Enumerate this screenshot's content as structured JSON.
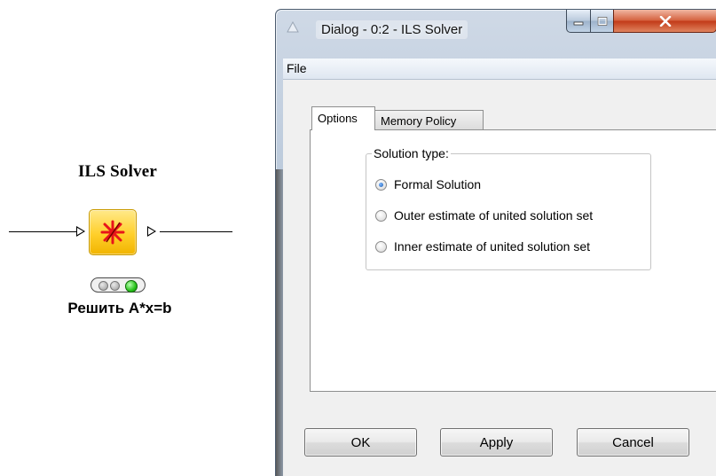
{
  "node": {
    "title": "ILS Solver",
    "label": "Решить A*x=b",
    "status": "executed",
    "icon": "red-star-icon"
  },
  "dialog": {
    "title": "Dialog - 0:2 - ILS Solver",
    "menu": {
      "file_label": "File"
    },
    "tabs": [
      {
        "label": "Options",
        "selected": true
      },
      {
        "label": "Memory Policy",
        "selected": false
      }
    ],
    "group": {
      "legend": "Solution type:",
      "options": [
        {
          "label": "Formal Solution",
          "checked": true
        },
        {
          "label": "Outer estimate of united solution set",
          "checked": false
        },
        {
          "label": "Inner estimate of united solution set",
          "checked": false
        }
      ]
    },
    "buttons": {
      "ok": "OK",
      "apply": "Apply",
      "cancel": "Cancel"
    }
  },
  "colors": {
    "node_fill": "#ffcf2a",
    "status_green": "#27c21a",
    "close_button": "#c23a18",
    "radio_selected": "#1f5fb0"
  }
}
